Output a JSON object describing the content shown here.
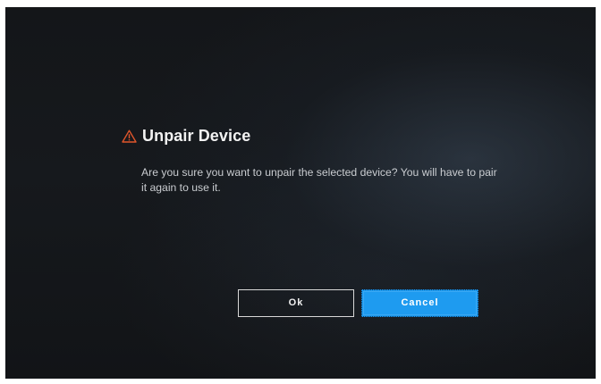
{
  "dialog": {
    "icon": "warning-triangle-icon",
    "title": "Unpair Device",
    "message": "Are you sure you want to unpair the selected device? You will have to pair it again to use it.",
    "buttons": {
      "ok_label": "Ok",
      "cancel_label": "Cancel"
    }
  },
  "colors": {
    "background": "#15181c",
    "warning_icon": "#e0552b",
    "title_text": "#f2f2f2",
    "message_text": "#c9ccd0",
    "primary_button": "#1e9bf0"
  }
}
